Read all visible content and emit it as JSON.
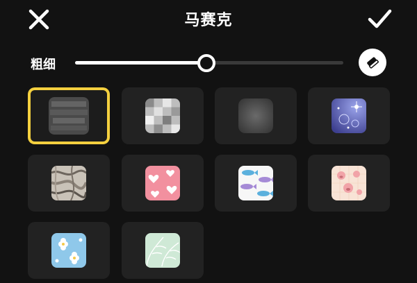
{
  "header": {
    "title": "马赛克",
    "close_icon": "close-x-icon",
    "confirm_icon": "checkmark-icon"
  },
  "brush": {
    "label": "粗细",
    "value_fraction": 0.49,
    "eraser_icon": "eraser-icon"
  },
  "colors": {
    "background": "#121212",
    "tile": "#222222",
    "selected_outline": "#f4d03f",
    "track_active": "#ffffff",
    "track_inactive": "#3a3a3a"
  },
  "mosaic_styles": [
    {
      "id": "blur-pixel",
      "selected": true
    },
    {
      "id": "checker-pixel",
      "selected": false
    },
    {
      "id": "soft-blur",
      "selected": false
    },
    {
      "id": "sparkle-purple",
      "selected": false
    },
    {
      "id": "marble",
      "selected": false
    },
    {
      "id": "pink-hearts",
      "selected": false
    },
    {
      "id": "blue-fish",
      "selected": false
    },
    {
      "id": "pink-pig",
      "selected": false
    },
    {
      "id": "blue-flowers",
      "selected": false
    },
    {
      "id": "green-leaves",
      "selected": false
    }
  ]
}
